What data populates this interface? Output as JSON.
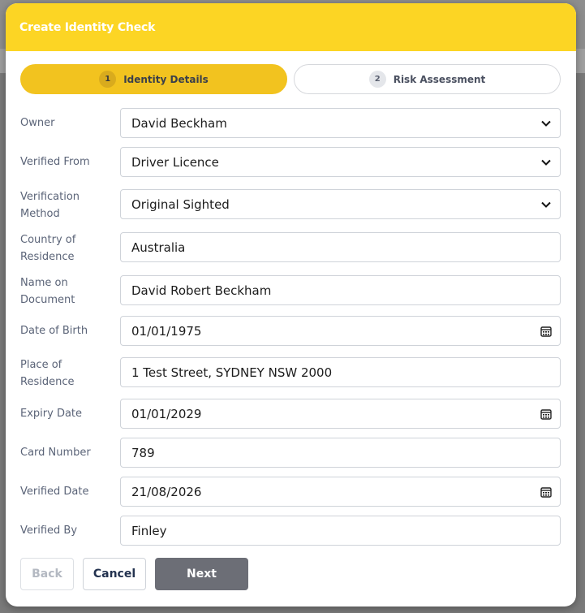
{
  "backdrop": {
    "glyph": "x"
  },
  "modal": {
    "title": "Create Identity Check"
  },
  "steps": [
    {
      "number": "1",
      "label": "Identity Details",
      "active": true
    },
    {
      "number": "2",
      "label": "Risk Assessment",
      "active": false
    }
  ],
  "form": {
    "owner": {
      "label": "Owner",
      "value": "David Beckham"
    },
    "verified_from": {
      "label": "Verified From",
      "value": "Driver Licence"
    },
    "verification_method": {
      "label": "Verification Method",
      "value": "Original Sighted"
    },
    "country_of_residence": {
      "label": "Country of Residence",
      "value": "Australia"
    },
    "name_on_document": {
      "label": "Name on Document",
      "value": "David Robert Beckham"
    },
    "date_of_birth": {
      "label": "Date of Birth",
      "value": "01/01/1975"
    },
    "place_of_residence": {
      "label": "Place of Residence",
      "value": "1 Test Street, SYDNEY NSW 2000"
    },
    "expiry_date": {
      "label": "Expiry Date",
      "value": "01/01/2029"
    },
    "card_number": {
      "label": "Card Number",
      "value": "789"
    },
    "verified_date": {
      "label": "Verified Date",
      "value": "21/08/2026"
    },
    "verified_by": {
      "label": "Verified By",
      "value": "Finley"
    }
  },
  "buttons": {
    "back": "Back",
    "cancel": "Cancel",
    "next": "Next"
  },
  "colors": {
    "accent": "#fcd524",
    "active_step": "#f2c31f",
    "next_button": "#6c6e76"
  },
  "icons": {
    "select": "chevron-down-icon",
    "date": "calendar-icon"
  }
}
